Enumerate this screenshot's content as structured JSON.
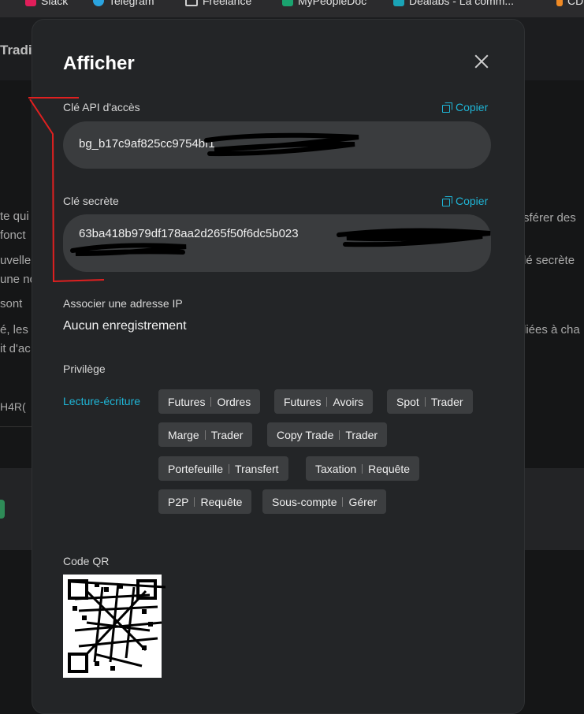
{
  "bookmarks": [
    {
      "label": "Slack",
      "icon": "slack-icon",
      "color": "#e01e5a"
    },
    {
      "label": "Telegram",
      "icon": "telegram-icon",
      "color": "#2aa3df"
    },
    {
      "label": "Freelance",
      "icon": "folder-icon",
      "color": "#cfcfcf"
    },
    {
      "label": "MyPeopleDoc",
      "icon": "mypeopledoc-icon",
      "color": "#1aa36f"
    },
    {
      "label": "Dealabs - La comm...",
      "icon": "dealabs-icon",
      "color": "#1aa3b6"
    },
    {
      "label": "CD...",
      "icon": "cdiscount-icon",
      "color": "#f08a24"
    }
  ],
  "background": {
    "title": "Tradi",
    "lines_left": [
      "te qui",
      "fonct",
      "uvelle",
      "une no",
      "sont",
      "é, les",
      "it d'ac",
      "H4R("
    ],
    "lines_right": [
      "sférer des",
      "lé secrète",
      "liées à cha"
    ]
  },
  "modal": {
    "title": "Afficher",
    "api_key": {
      "label": "Clé API d'accès",
      "copy_label": "Copier",
      "value": "bg_b17c9af825cc9754bf1"
    },
    "secret_key": {
      "label": "Clé secrète",
      "copy_label": "Copier",
      "value": "63ba418b979df178aa2d265f50f6dc5b023"
    },
    "ip": {
      "label": "Associer une adresse IP",
      "value": "Aucun enregistrement"
    },
    "privilege": {
      "label": "Privilège",
      "type": "Lecture-écriture",
      "tags": [
        [
          "Futures",
          "Ordres"
        ],
        [
          "Futures",
          "Avoirs"
        ],
        [
          "Spot",
          "Trader"
        ],
        [
          "Marge",
          "Trader"
        ],
        [
          "Copy Trade",
          "Trader"
        ],
        [
          "Portefeuille",
          "Transfert"
        ],
        [
          "Taxation",
          "Requête"
        ],
        [
          "P2P",
          "Requête"
        ],
        [
          "Sous-compte",
          "Gérer"
        ]
      ]
    },
    "qr_label": "Code QR"
  },
  "colors": {
    "accent": "#1fb5d6",
    "annotation": "#e02020"
  }
}
